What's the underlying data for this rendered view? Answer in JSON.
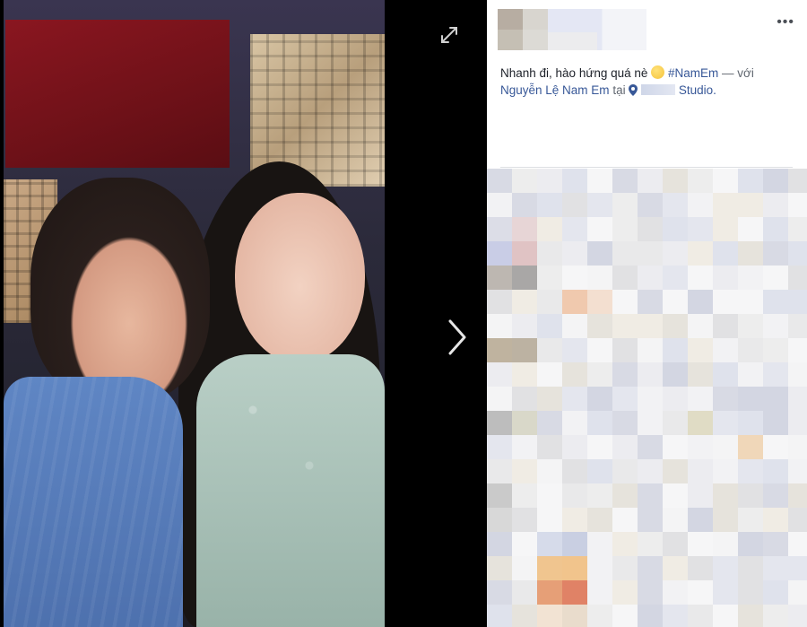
{
  "viewer": {
    "expand_icon": "expand-icon",
    "next_icon": "chevron-right-icon"
  },
  "post": {
    "more_icon": "more-options-icon",
    "caption": {
      "text_start": "Nhanh đi, hào hứng quá nè",
      "hashtag": "#NamEm",
      "with_text": "— với",
      "tagged_person": "Nguyễn Lệ Nam Em",
      "at_text": "tại",
      "place_suffix": "Studio."
    }
  },
  "colors": {
    "link": "#385898",
    "text": "#1d2129",
    "divider": "#dddfe2"
  }
}
